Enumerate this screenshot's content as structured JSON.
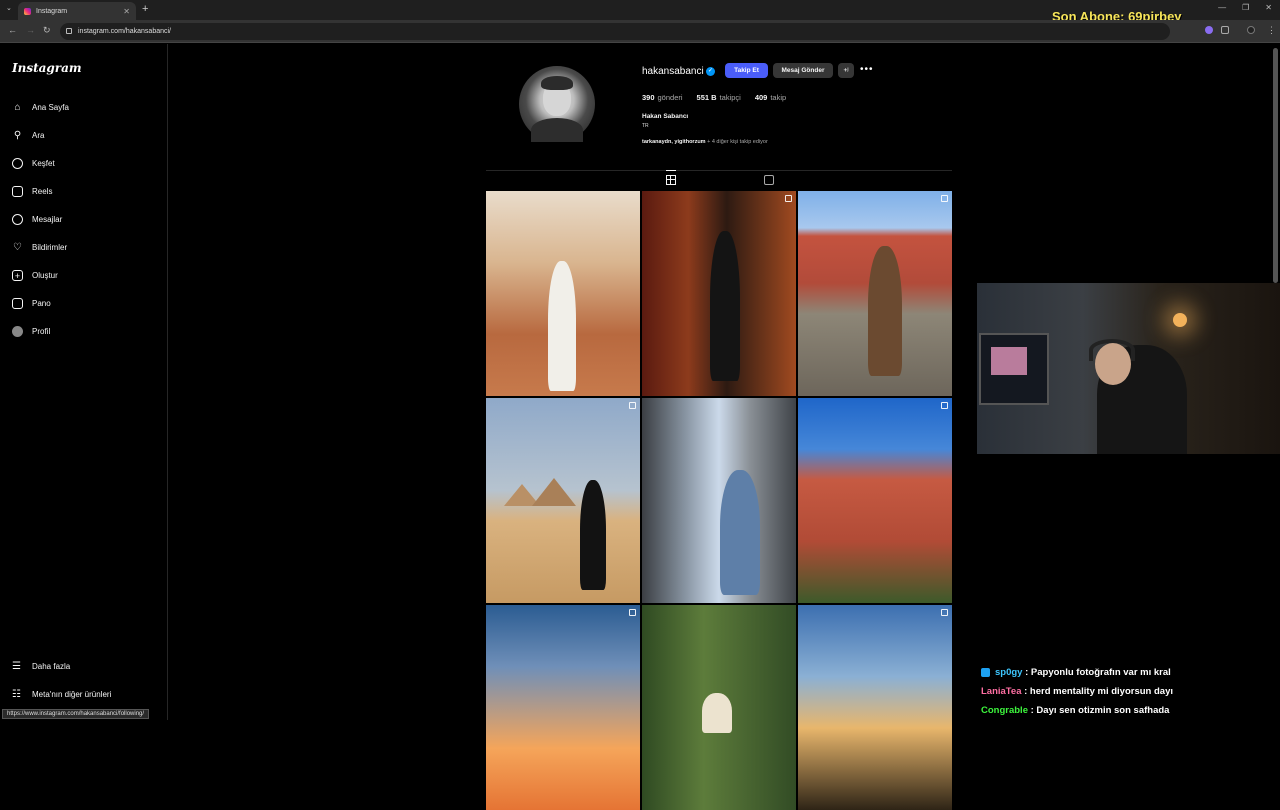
{
  "browser": {
    "tab_title": "Instagram",
    "tab_close": "✕",
    "new_tab": "+",
    "url": "instagram.com/hakansabanci/",
    "status_url": "https://www.instagram.com/hakansabanci/following/"
  },
  "overlay": {
    "title": "Son Abone: 69pirbey"
  },
  "sidebar": {
    "logo": "Instagram",
    "items": [
      {
        "label": "Ana Sayfa",
        "icon": "home-icon"
      },
      {
        "label": "Ara",
        "icon": "search-icon"
      },
      {
        "label": "Keşfet",
        "icon": "compass-icon"
      },
      {
        "label": "Reels",
        "icon": "reels-icon"
      },
      {
        "label": "Mesajlar",
        "icon": "messenger-icon"
      },
      {
        "label": "Bildirimler",
        "icon": "heart-icon"
      },
      {
        "label": "Oluştur",
        "icon": "plus-icon"
      },
      {
        "label": "Pano",
        "icon": "dashboard-icon"
      },
      {
        "label": "Profil",
        "icon": "avatar-icon"
      }
    ],
    "more": "Daha fazla",
    "meta": "Meta'nın diğer ürünleri"
  },
  "profile": {
    "username": "hakansabanci",
    "follow_label": "Takip Et",
    "message_label": "Mesaj Gönder",
    "add_person": "+ʲ",
    "more": "•••",
    "posts_count": "390",
    "posts_label": "gönderi",
    "followers_count": "551 B",
    "followers_label": "takipçi",
    "following_count": "409",
    "following_label": "takip",
    "full_name": "Hakan Sabancı",
    "bio": "TR",
    "followed_by_names": "tarkanaydn, yigithorzum",
    "followed_by_rest": " + 4 diğer kişi takip ediyor"
  },
  "chat": [
    {
      "user": "sp0gy",
      "color": "#3ec7ff",
      "message": ": Papyonlu fotoğrafın var mı kral"
    },
    {
      "user": "LaniaTea",
      "color": "#ff6fa3",
      "message": ": herd mentality mi diyorsun dayı"
    },
    {
      "user": "Congrable",
      "color": "#3df53d",
      "message": ": Dayı sen otizmin son safhada"
    }
  ]
}
